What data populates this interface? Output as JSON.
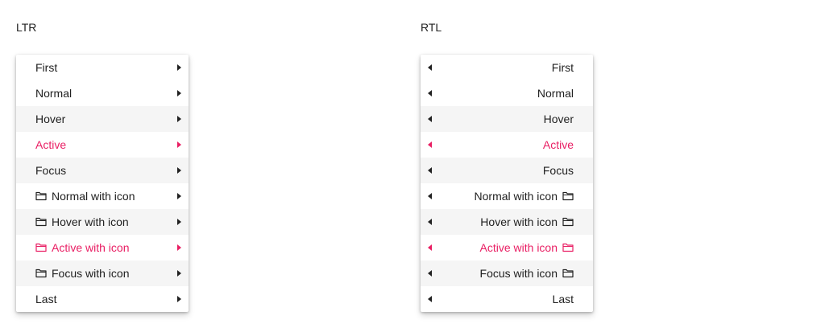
{
  "ltr": {
    "caption": "LTR",
    "items": [
      {
        "label": "First"
      },
      {
        "label": "Normal"
      },
      {
        "label": "Hover"
      },
      {
        "label": "Active"
      },
      {
        "label": "Focus"
      },
      {
        "label": "Normal with icon",
        "icon": "folder-icon"
      },
      {
        "label": "Hover with icon",
        "icon": "folder-icon"
      },
      {
        "label": "Active with icon",
        "icon": "folder-icon"
      },
      {
        "label": "Focus with icon",
        "icon": "folder-icon"
      },
      {
        "label": "Last"
      }
    ]
  },
  "rtl": {
    "caption": "RTL",
    "items": [
      {
        "label": "First"
      },
      {
        "label": "Normal"
      },
      {
        "label": "Hover"
      },
      {
        "label": "Active"
      },
      {
        "label": "Focus"
      },
      {
        "label": "Normal with icon",
        "icon": "folder-icon"
      },
      {
        "label": "Hover with icon",
        "icon": "folder-icon"
      },
      {
        "label": "Active with icon",
        "icon": "folder-icon"
      },
      {
        "label": "Focus with icon",
        "icon": "folder-icon"
      },
      {
        "label": "Last"
      }
    ]
  },
  "colors": {
    "text": "#212121",
    "active": "#e91e63",
    "shaded_background": "#f5f5f5",
    "menu_background": "#ffffff"
  }
}
